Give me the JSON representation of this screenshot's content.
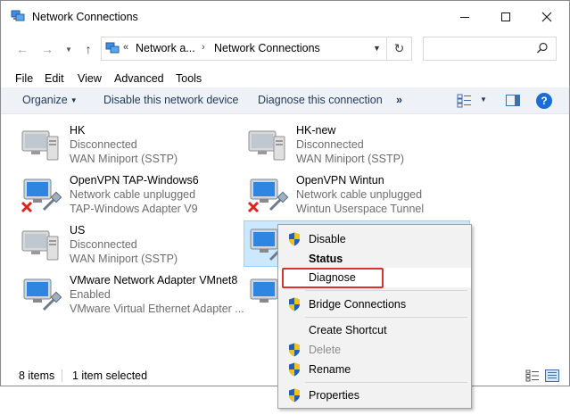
{
  "window": {
    "title": "Network Connections"
  },
  "address": {
    "prefix": "«",
    "crumbs": [
      "Network a...",
      "Network Connections"
    ],
    "separator": "›"
  },
  "search": {
    "placeholder": ""
  },
  "menubar": [
    "File",
    "Edit",
    "View",
    "Advanced",
    "Tools"
  ],
  "toolbar": {
    "organize": "Organize",
    "disable": "Disable this network device",
    "diagnose": "Diagnose this connection",
    "more": "»",
    "help": "?"
  },
  "items": [
    {
      "name": "HK",
      "status": "Disconnected",
      "device": "WAN Miniport (SSTP)",
      "type": "wan",
      "error": false
    },
    {
      "name": "HK-new",
      "status": "Disconnected",
      "device": "WAN Miniport (SSTP)",
      "type": "wan",
      "error": false
    },
    {
      "name": "OpenVPN TAP-Windows6",
      "status": "Network cable unplugged",
      "device": "TAP-Windows Adapter V9",
      "type": "lan",
      "error": true
    },
    {
      "name": "OpenVPN Wintun",
      "status": "Network cable unplugged",
      "device": "Wintun Userspace Tunnel",
      "type": "lan",
      "error": true
    },
    {
      "name": "US",
      "status": "Disconnected",
      "device": "WAN Miniport (SSTP)",
      "type": "wan",
      "error": false
    },
    {
      "name": "",
      "status": "",
      "device": "",
      "type": "lan",
      "error": false,
      "selected": true
    },
    {
      "name": "VMware Network Adapter VMnet8",
      "status": "Enabled",
      "device": "VMware Virtual Ethernet Adapter ...",
      "type": "lan",
      "error": false
    },
    {
      "name": "",
      "status": "",
      "device": "",
      "type": "lan",
      "error": false
    }
  ],
  "statusbar": {
    "count": "8 items",
    "selected": "1 item selected"
  },
  "context_menu": {
    "disable": "Disable",
    "status": "Status",
    "diagnose": "Diagnose",
    "bridge": "Bridge Connections",
    "shortcut": "Create Shortcut",
    "delete": "Delete",
    "rename": "Rename",
    "properties": "Properties"
  },
  "colors": {
    "accent": "#1a6cd6",
    "selection": "#cce8ff",
    "highlight": "#e0302a",
    "error": "#d9251d"
  }
}
